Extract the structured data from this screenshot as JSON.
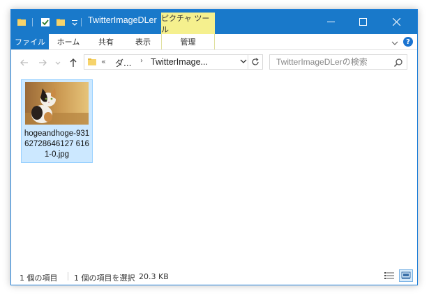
{
  "window": {
    "title": "TwitterImageDLer",
    "contextual_tab": "ピクチャ ツール"
  },
  "ribbon": {
    "tabs": [
      "ファイル",
      "ホーム",
      "共有",
      "表示"
    ],
    "manage_tab": "管理"
  },
  "address": {
    "overflow": "«",
    "crumb1": "ダ...",
    "crumb2": "TwitterImage..."
  },
  "search": {
    "placeholder": "TwitterImageDLerの検索"
  },
  "files": [
    {
      "name": "hogeandhoge-93162728646127 6161-0.jpg",
      "icon": "cat-photo-thumbnail"
    }
  ],
  "status": {
    "count": "1 個の項目",
    "selected": "1 個の項目を選択",
    "size": "20.3 KB"
  },
  "colors": {
    "titlebar": "#1979ca",
    "contextual_tab": "#f5f08e",
    "selection_bg": "#cce8ff",
    "selection_border": "#99d1ff"
  }
}
